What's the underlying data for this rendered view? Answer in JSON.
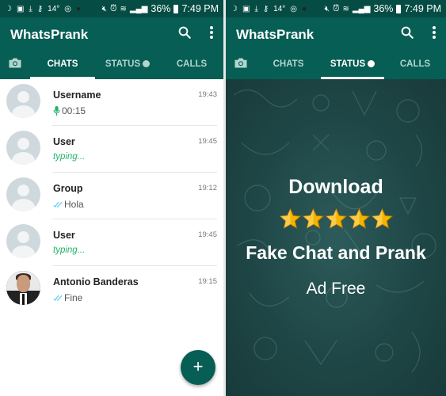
{
  "status_bar": {
    "left_icons": [
      "moon-icon",
      "image-icon",
      "download-icon",
      "key-icon",
      "temperature-icon",
      "camera-sync-icon",
      "flame-icon"
    ],
    "temperature": "14°",
    "battery": "36%",
    "time": "7:49 PM"
  },
  "app": {
    "title": "WhatsPrank",
    "tabs": [
      "CHATS",
      "STATUS",
      "CALLS"
    ]
  },
  "left_screen": {
    "active_tab": "CHATS",
    "chats": [
      {
        "name": "Username",
        "time": "19:43",
        "preview": "00:15",
        "preview_type": "voice"
      },
      {
        "name": "User",
        "time": "19:45",
        "preview": "typing...",
        "preview_type": "typing"
      },
      {
        "name": "Group",
        "time": "19:12",
        "preview": "Hola",
        "preview_type": "read"
      },
      {
        "name": "User",
        "time": "19:45",
        "preview": "typing...",
        "preview_type": "typing"
      },
      {
        "name": "Antonio Banderas",
        "time": "19:15",
        "preview": "Fine",
        "preview_type": "read"
      }
    ],
    "fab_label": "+"
  },
  "right_screen": {
    "active_tab": "STATUS",
    "promo": {
      "line1": "Download",
      "rating_stars": 5,
      "line2": "Fake Chat and Prank",
      "line3": "Ad Free"
    }
  },
  "colors": {
    "primary": "#075e54",
    "status_bar": "#054d44",
    "typing": "#25b36b",
    "read_ticks": "#4fc3f7",
    "star": "#f4b400"
  }
}
